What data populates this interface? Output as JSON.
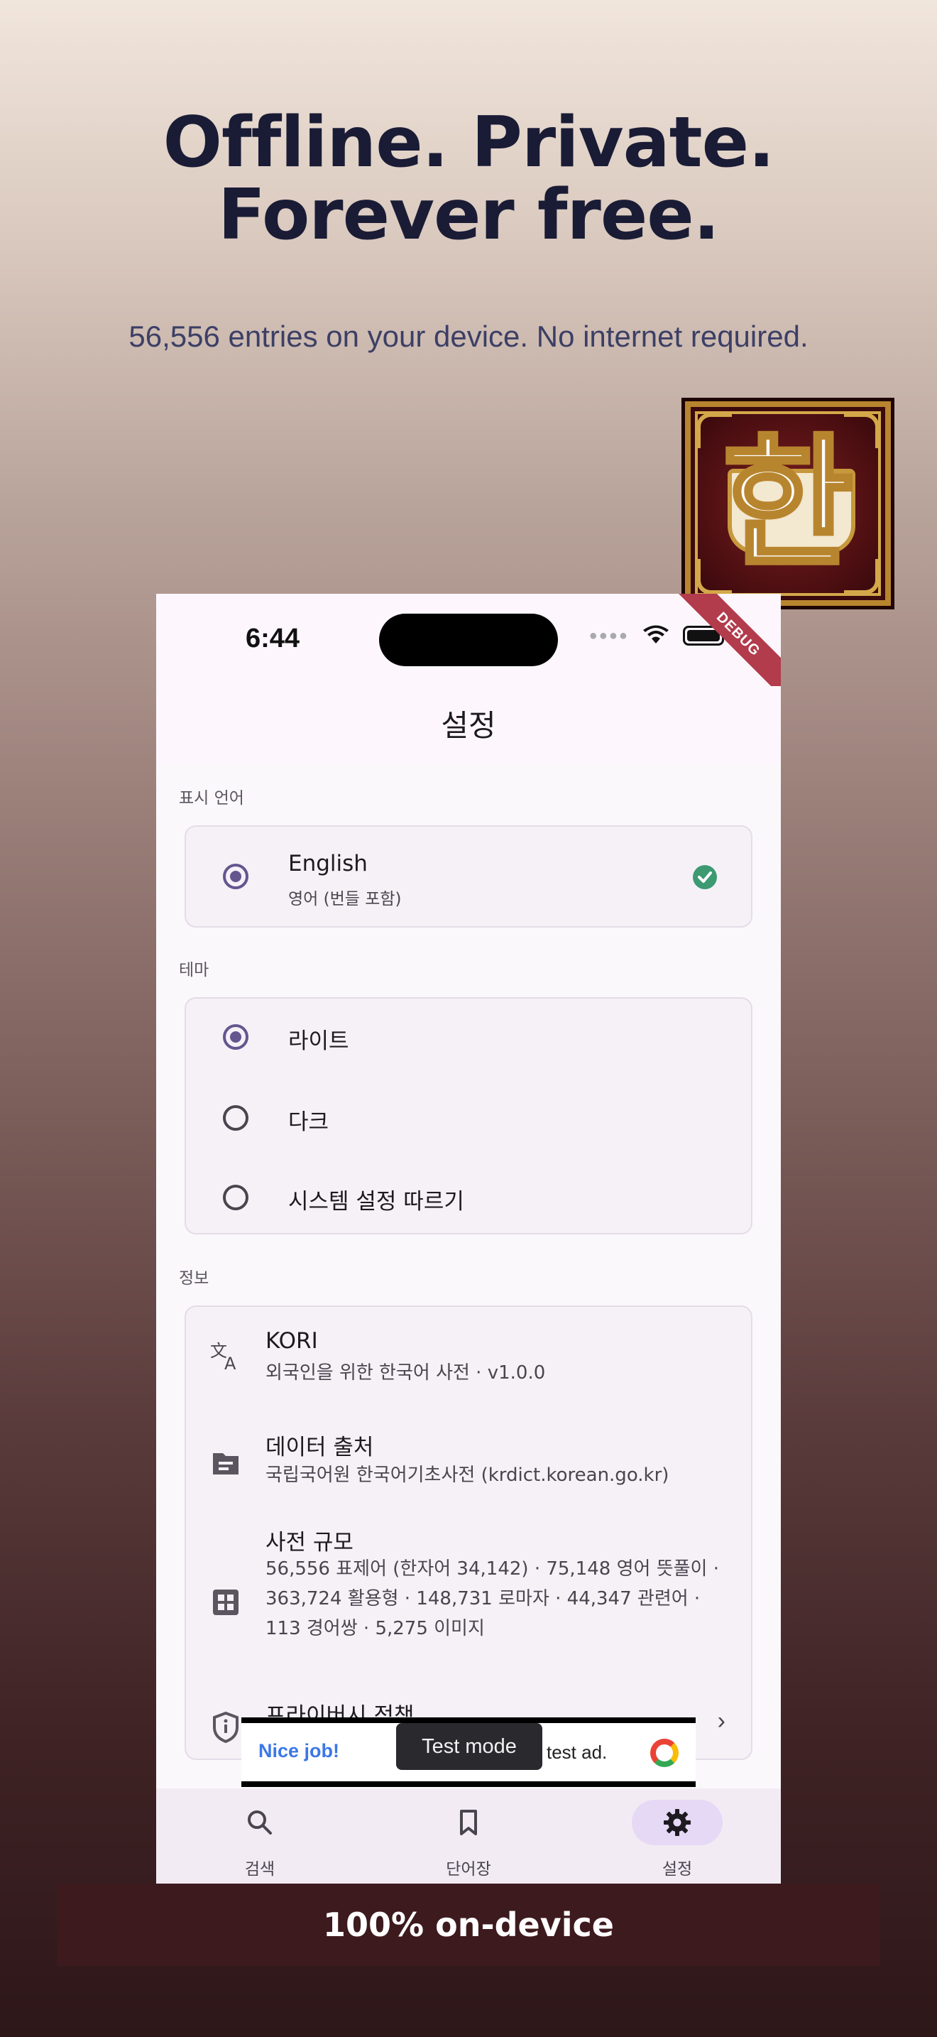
{
  "promo": {
    "headline_line1": "Offline. Private.",
    "headline_line2": "Forever free.",
    "subline": "56,556 entries on your device. No internet required.",
    "app_icon_glyph": "한",
    "footer": "100% on-device"
  },
  "status_bar": {
    "time": "6:44",
    "debug_label": "DEBUG"
  },
  "app_bar": {
    "title": "설정"
  },
  "language_section": {
    "label": "표시 언어",
    "option": {
      "label": "English",
      "sub": "영어 (번들 포함)",
      "selected": true
    }
  },
  "theme_section": {
    "label": "테마",
    "options": [
      {
        "label": "라이트",
        "selected": true
      },
      {
        "label": "다크",
        "selected": false
      },
      {
        "label": "시스템 설정 따르기",
        "selected": false
      }
    ]
  },
  "info_section": {
    "label": "정보",
    "items": [
      {
        "icon": "translate-icon",
        "title": "KORI",
        "sub": "외국인을 위한 한국어 사전 · v1.0.0"
      },
      {
        "icon": "folder-icon",
        "title": "데이터 출처",
        "sub": "국립국어원 한국어기초사전 (krdict.korean.go.kr)"
      },
      {
        "icon": "grid-icon",
        "title": "사전 규모",
        "sub": "56,556 표제어 (한자어 34,142) · 75,148 영어 뜻풀이 · 363,724 활용형 · 148,731 로마자 · 44,347 관련어 · 113 경어쌍 · 5,275 이미지"
      },
      {
        "icon": "shield-icon",
        "title": "프라이버시 정책",
        "sub": ""
      }
    ]
  },
  "ad": {
    "nice_job": "Nice job!",
    "text": "test ad.",
    "toast": "Test mode"
  },
  "nav": {
    "items": [
      {
        "label": "검색",
        "icon": "search-icon",
        "active": false
      },
      {
        "label": "단어장",
        "icon": "bookmark-icon",
        "active": false
      },
      {
        "label": "설정",
        "icon": "gear-icon",
        "active": true
      }
    ]
  },
  "colors": {
    "accent": "#65558f",
    "check": "#3d9a72",
    "headline": "#1a1c36",
    "footer_bg": "#3d1a1e"
  }
}
